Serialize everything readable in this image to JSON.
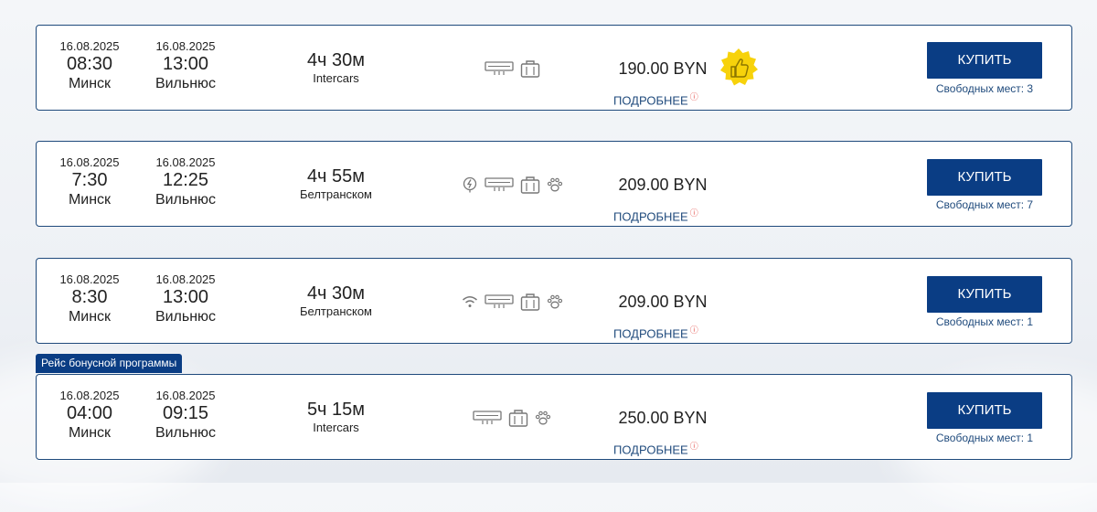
{
  "trips": [
    {
      "dep_date": "16.08.2025",
      "dep_time": "08:30",
      "dep_city": "Минск",
      "arr_date": "16.08.2025",
      "arr_time": "13:00",
      "arr_city": "Вильнюс",
      "duration": "4ч 30м",
      "carrier": "Intercars",
      "amenities": [
        "air-conditioning",
        "luggage"
      ],
      "price": "190.00 BYN",
      "details": "ПОДРОБНЕЕ",
      "buy": "КУПИТЬ",
      "seats": "Свободных мест: 3",
      "recommended": true
    },
    {
      "dep_date": "16.08.2025",
      "dep_time": "7:30",
      "dep_city": "Минск",
      "arr_date": "16.08.2025",
      "arr_time": "12:25",
      "arr_city": "Вильнюс",
      "duration": "4ч 55м",
      "carrier": "Белтранском",
      "amenities": [
        "charging",
        "air-conditioning",
        "luggage",
        "pets"
      ],
      "price": "209.00 BYN",
      "details": "ПОДРОБНЕЕ",
      "buy": "КУПИТЬ",
      "seats": "Свободных мест: 7"
    },
    {
      "dep_date": "16.08.2025",
      "dep_time": "8:30",
      "dep_city": "Минск",
      "arr_date": "16.08.2025",
      "arr_time": "13:00",
      "arr_city": "Вильнюс",
      "duration": "4ч 30м",
      "carrier": "Белтранском",
      "amenities": [
        "wifi",
        "air-conditioning",
        "luggage",
        "pets"
      ],
      "price": "209.00 BYN",
      "details": "ПОДРОБНЕЕ",
      "buy": "КУПИТЬ",
      "seats": "Свободных мест: 1"
    },
    {
      "dep_date": "16.08.2025",
      "dep_time": "04:00",
      "dep_city": "Минск",
      "arr_date": "16.08.2025",
      "arr_time": "09:15",
      "arr_city": "Вильнюс",
      "duration": "5ч 15м",
      "carrier": "Intercars",
      "amenities": [
        "air-conditioning",
        "luggage",
        "pets"
      ],
      "price": "250.00 BYN",
      "details": "ПОДРОБНЕЕ",
      "buy": "КУПИТЬ",
      "seats": "Свободных мест: 1"
    }
  ],
  "bonus_label": "Рейс бонусной программы",
  "colors": {
    "primary": "#0a3d84",
    "border": "#1f4a7c",
    "info": "#e0403b",
    "badge": "#f7d20b"
  }
}
